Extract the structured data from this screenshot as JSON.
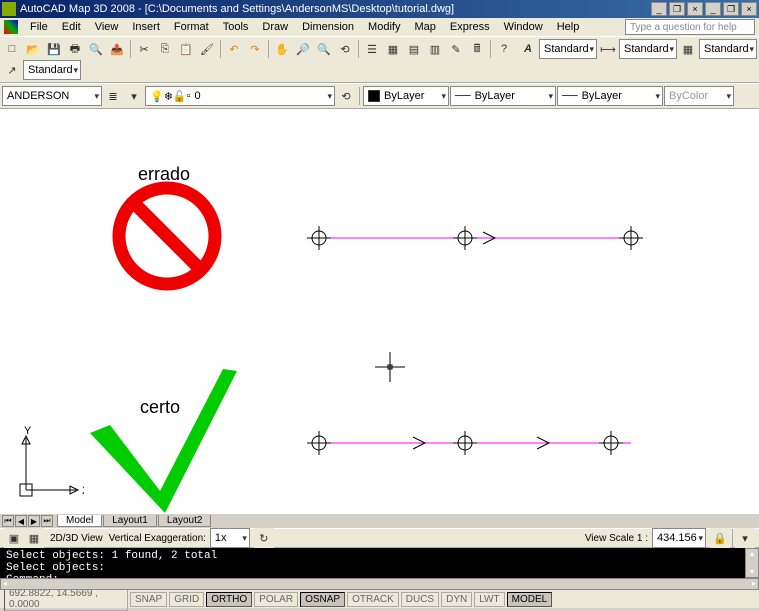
{
  "app": {
    "title": "AutoCAD Map 3D 2008 - [C:\\Documents and Settings\\AndersonMS\\Desktop\\tutorial.dwg]"
  },
  "menu": {
    "items": [
      "File",
      "Edit",
      "View",
      "Insert",
      "Format",
      "Tools",
      "Draw",
      "Dimension",
      "Modify",
      "Map",
      "Express",
      "Window",
      "Help"
    ],
    "help_placeholder": "Type a question for help"
  },
  "layerbar": {
    "drawing": "ANDERSON",
    "layer": "0",
    "color_label": "ByLayer",
    "linetype": "ByLayer",
    "lineweight": "ByLayer",
    "plotstyle": "ByColor"
  },
  "stylebar": {
    "a": "Standard",
    "b": "Standard",
    "c": "Standard",
    "d": "Standard"
  },
  "canvas": {
    "label_wrong": "errado",
    "label_right": "certo",
    "axis_y": "Y",
    "axis_x": "X"
  },
  "tabs": {
    "items": [
      "Model",
      "Layout1",
      "Layout2"
    ]
  },
  "viewbar": {
    "mode": "2D/3D View",
    "vex_label": "Vertical Exaggeration:",
    "vex_value": "1x",
    "scale_label": "View Scale 1 :",
    "scale_value": "434.156"
  },
  "cmd": {
    "line1": "Select objects: 1 found, 2 total",
    "line2": "Select objects:",
    "prompt": "Command:"
  },
  "status": {
    "coords": "692.8822, 14.5669 , 0.0000",
    "buttons": [
      "SNAP",
      "GRID",
      "ORTHO",
      "POLAR",
      "OSNAP",
      "OTRACK",
      "DUCS",
      "DYN",
      "LWT",
      "MODEL"
    ],
    "active": [
      "ORTHO",
      "OSNAP",
      "MODEL"
    ]
  }
}
